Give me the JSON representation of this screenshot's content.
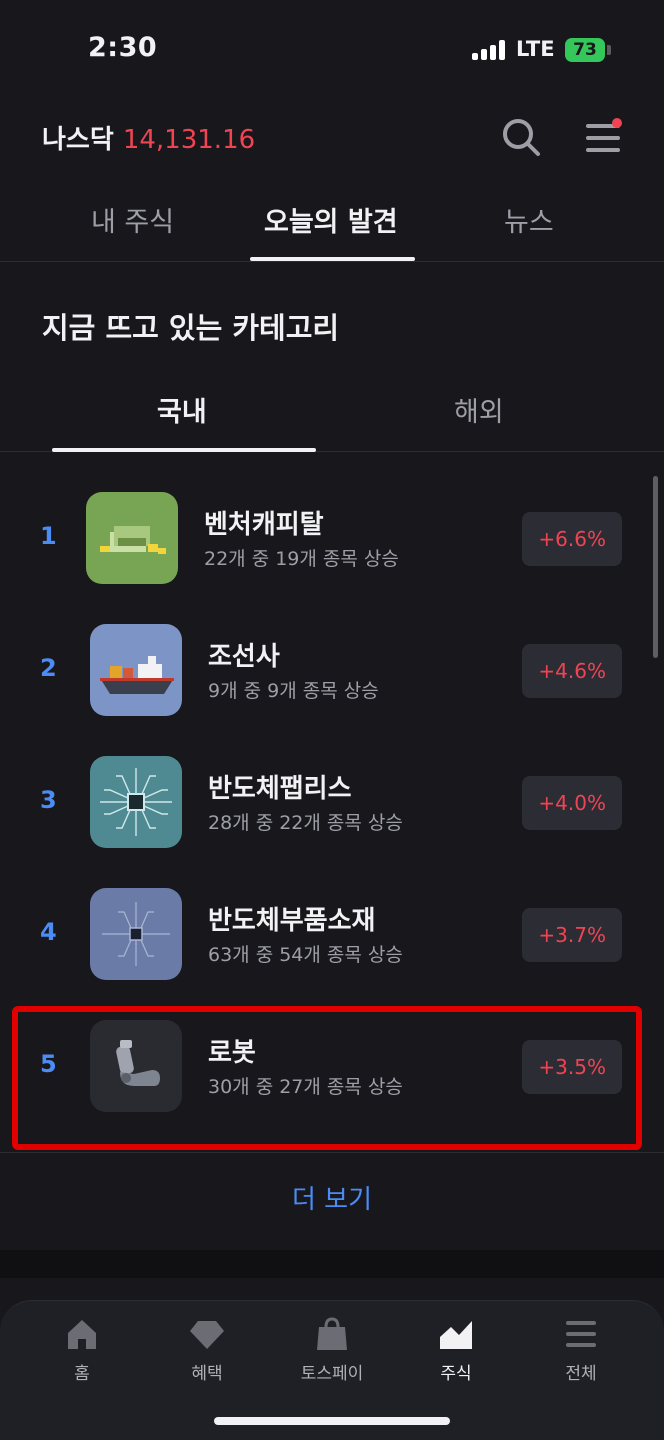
{
  "status_bar": {
    "time": "2:30",
    "network": "LTE",
    "battery": "73"
  },
  "header": {
    "index_name": "나스닥",
    "index_value": "14,131.16"
  },
  "top_tabs": [
    "내 주식",
    "오늘의 발견",
    "뉴스"
  ],
  "section": {
    "title": "지금 뜨고 있는 카테고리"
  },
  "sub_tabs": [
    "국내",
    "해외"
  ],
  "categories": [
    {
      "rank": "1",
      "name": "벤처캐피탈",
      "summary": "22개 중 19개 종목 상승",
      "change": "+6.6%"
    },
    {
      "rank": "2",
      "name": "조선사",
      "summary": "9개 중 9개 종목 상승",
      "change": "+4.6%"
    },
    {
      "rank": "3",
      "name": "반도체팹리스",
      "summary": "28개 중 22개 종목 상승",
      "change": "+4.0%"
    },
    {
      "rank": "4",
      "name": "반도체부품소재",
      "summary": "63개 중 54개 종목 상승",
      "change": "+3.7%"
    },
    {
      "rank": "5",
      "name": "로봇",
      "summary": "30개 중 27개 종목 상승",
      "change": "+3.5%"
    }
  ],
  "more_label": "더 보기",
  "bottom_nav": [
    {
      "label": "홈",
      "icon": "home-icon"
    },
    {
      "label": "혜택",
      "icon": "gem-icon"
    },
    {
      "label": "토스페이",
      "icon": "shopping-bag-icon"
    },
    {
      "label": "주식",
      "icon": "stock-chart-icon"
    },
    {
      "label": "전체",
      "icon": "hamburger-icon"
    }
  ],
  "colors": {
    "accent_blue": "#4c8cf5",
    "rise_red": "#f04452",
    "background": "#17171c",
    "highlight": "#e00000"
  }
}
